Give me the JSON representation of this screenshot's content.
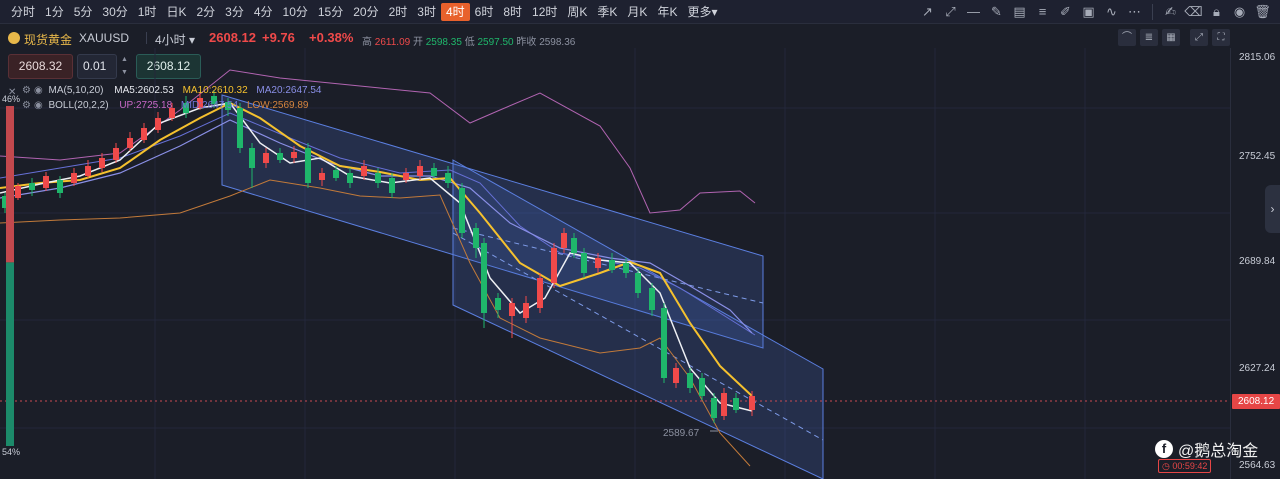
{
  "toolbar": {
    "timeframes": [
      "分时",
      "1分",
      "5分",
      "30分",
      "1时",
      "日K",
      "2分",
      "3分",
      "4分",
      "10分",
      "15分",
      "20分",
      "2时",
      "3时",
      "4时",
      "6时",
      "8时",
      "12时",
      "周K",
      "季K",
      "月K",
      "年K",
      "更多▾"
    ],
    "active_timeframe": "4时",
    "drawing_tools": [
      "trend-line-icon",
      "ray-icon",
      "horizontal-line-icon",
      "pen-icon",
      "parallel-channel-icon",
      "fibonacci-icon",
      "highlighter-icon",
      "image-icon",
      "polyline-icon",
      "more-tools-icon"
    ],
    "right_tools": [
      "edit-icon",
      "eraser-icon",
      "lock-icon",
      "eye-icon",
      "trash-icon"
    ]
  },
  "symbol": {
    "name": "现货黄金",
    "code": "XAUUSD",
    "period": "4小时 ▾",
    "price": "2608.12",
    "change": "+9.76",
    "change_pct": "+0.38%",
    "high_label": "高",
    "high": "2611.09",
    "open_label": "开",
    "open": "2598.35",
    "low_label": "低",
    "low": "2597.50",
    "prev_close_label": "昨收",
    "prev_close": "2598.36"
  },
  "order": {
    "sell_price": "2608.32",
    "quantity": "0.01",
    "buy_price": "2608.12"
  },
  "indicators": {
    "ma": {
      "name": "MA(5,10,20)",
      "ma5": "MA5:2602.53",
      "ma10": "MA10:2610.32",
      "ma20": "MA20:2647.54"
    },
    "boll": {
      "name": "BOLL(20,2,2)",
      "up": "UP:2725.18",
      "mid": "MID:2647.54",
      "low": "LOW:2569.89"
    }
  },
  "gauge": {
    "top_pct": "46%",
    "bottom_pct": "54%",
    "top_fraction": 0.46
  },
  "price_axis": {
    "labels": [
      "2815.06",
      "2752.45",
      "2689.84",
      "2627.24",
      "2564.63"
    ],
    "current": "2608.12"
  },
  "annotations": {
    "low_mark": "2589.67"
  },
  "watermark": {
    "text": "@鹅总淘金",
    "timer": "00:59:42"
  },
  "colors": {
    "up": "#f04a4a",
    "down": "#1fb66b",
    "accent": "#e8612c",
    "gold": "#e8b84a"
  }
}
